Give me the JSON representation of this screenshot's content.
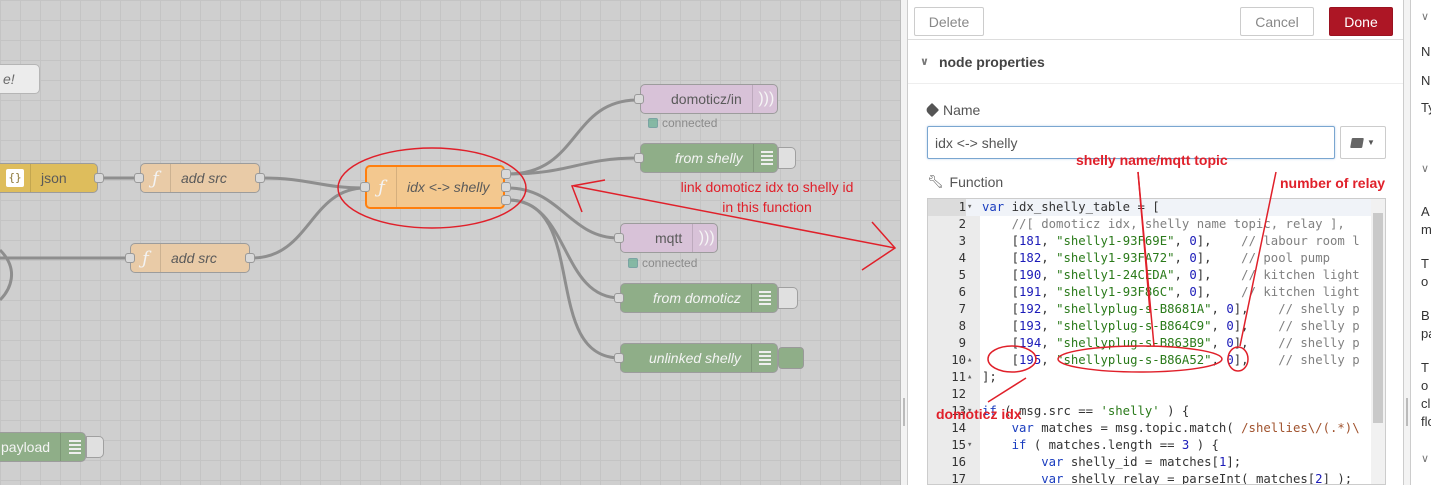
{
  "canvas": {
    "partial_comment": "e!",
    "nodes": {
      "json": "json",
      "add_src_1": "add src",
      "add_src_2": "add src",
      "idx_shelly": "idx <-> shelly",
      "domoticz_in": "domoticz/in",
      "from_shelly": "from shelly",
      "mqtt": "mqtt",
      "from_domoticz": "from domoticz",
      "unlinked_shelly": "unlinked shelly",
      "payload": "payload"
    },
    "status": {
      "domoticz_in": "connected",
      "mqtt": "connected"
    },
    "annotations": {
      "link_note": "link domoticz idx to shelly id in this function",
      "shelly_name": "shelly name/mqtt topic",
      "number_of_relay": "number of relay",
      "domoticz_idx": "domoticz idx"
    }
  },
  "tray": {
    "delete_label": "Delete",
    "cancel_label": "Cancel",
    "done_label": "Done",
    "section_title": "node properties",
    "name_label": "Name",
    "name_value": "idx <-> shelly",
    "function_label": "Function",
    "code_lines": [
      {
        "n": "1",
        "fold": "▾",
        "html": "<span class='c-kw'>var</span> idx_shelly_table = ["
      },
      {
        "n": "2",
        "fold": "",
        "html": "    <span class='c-com'>//[ domoticz idx, shelly name topic, relay ],</span>"
      },
      {
        "n": "3",
        "fold": "",
        "html": "    [<span class='c-num'>181</span>, <span class='c-str'>\"shelly1-93F69E\"</span>, <span class='c-num'>0</span>],    <span class='c-com'>// labour room l</span>"
      },
      {
        "n": "4",
        "fold": "",
        "html": "    [<span class='c-num'>182</span>, <span class='c-str'>\"shelly1-93FA72\"</span>, <span class='c-num'>0</span>],    <span class='c-com'>// pool pump</span>"
      },
      {
        "n": "5",
        "fold": "",
        "html": "    [<span class='c-num'>190</span>, <span class='c-str'>\"shelly1-24CEDA\"</span>, <span class='c-num'>0</span>],    <span class='c-com'>// kitchen light</span>"
      },
      {
        "n": "6",
        "fold": "",
        "html": "    [<span class='c-num'>191</span>, <span class='c-str'>\"shelly1-93F86C\"</span>, <span class='c-num'>0</span>],    <span class='c-com'>// kitchen light</span>"
      },
      {
        "n": "7",
        "fold": "",
        "html": "    [<span class='c-num'>192</span>, <span class='c-str'>\"shellyplug-s-B8681A\"</span>, <span class='c-num'>0</span>],    <span class='c-com'>// shelly p</span>"
      },
      {
        "n": "8",
        "fold": "",
        "html": "    [<span class='c-num'>193</span>, <span class='c-str'>\"shellyplug-s-B864C9\"</span>, <span class='c-num'>0</span>],    <span class='c-com'>// shelly p</span>"
      },
      {
        "n": "9",
        "fold": "",
        "html": "    [<span class='c-num'>194</span>, <span class='c-str'>\"shellyplug-s-B863B9\"</span>, <span class='c-num'>0</span>],    <span class='c-com'>// shelly p</span>"
      },
      {
        "n": "10",
        "fold": "▴",
        "html": "    [<span class='c-num'>195</span>, <span class='c-str'>\"shellyplug-s-B86A52\"</span>, <span class='c-num'>0</span>],    <span class='c-com'>// shelly p</span>"
      },
      {
        "n": "11",
        "fold": "▴",
        "html": "];"
      },
      {
        "n": "12",
        "fold": "",
        "html": ""
      },
      {
        "n": "13",
        "fold": "▾",
        "html": "<span class='c-kw'>if</span> ( msg.src == <span class='c-str'>'shelly'</span> ) {"
      },
      {
        "n": "14",
        "fold": "",
        "html": "    <span class='c-kw'>var</span> matches = msg.topic.match( <span class='c-re'>/shellies\\/(.*)\\</span>"
      },
      {
        "n": "15",
        "fold": "▾",
        "html": "    <span class='c-kw'>if</span> ( matches.length == <span class='c-num'>3</span> ) {"
      },
      {
        "n": "16",
        "fold": "",
        "html": "        <span class='c-kw'>var</span> shelly_id = matches[<span class='c-num'>1</span>];"
      },
      {
        "n": "17",
        "fold": "",
        "html": "        <span class='c-kw'>var</span> shelly_relay = parseInt( matches[<span class='c-num'>2</span>] );"
      }
    ]
  },
  "sidebar": {
    "row1": "N",
    "row2": "N",
    "row3": "Ty",
    "p1a": "A",
    "p1b": "m",
    "p2a": "T",
    "p2b": "o",
    "p3a": "B",
    "p3b": "pa",
    "p4a": "T",
    "p4b": "o",
    "p4c": "cl",
    "p4d": "flo"
  },
  "colors": {
    "function_node": "#fdd0a2",
    "json_node": "#debd5c",
    "mqtt_node": "#d8bfd8",
    "link_node": "#87a980",
    "done_button": "#ad1625",
    "annotation": "#e0202a"
  }
}
